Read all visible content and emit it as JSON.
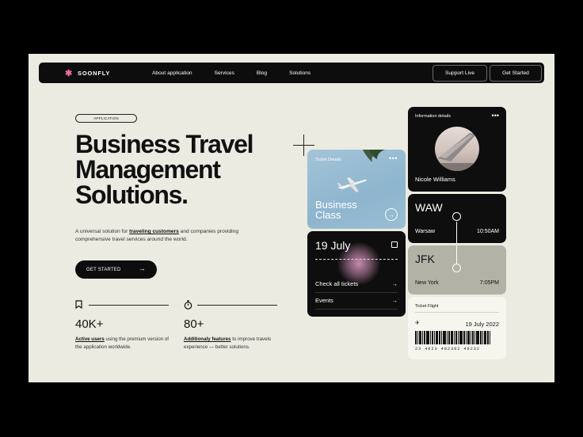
{
  "nav": {
    "brand": "SOONFLY",
    "links": [
      "About application",
      "Services",
      "Blog",
      "Solutions"
    ],
    "support_label": "Support Live",
    "start_label": "Get Started"
  },
  "hero": {
    "badge": "APPLICATION",
    "headline": [
      "Business Travel",
      "Management",
      "Solutions."
    ],
    "sub_pre": "A universal solution for ",
    "sub_bold": "traveling customers",
    "sub_post": " and companies providing comprehensive travel services around the world.",
    "cta": "GET STARTED"
  },
  "stats": [
    {
      "icon": "bookmark-icon",
      "value": "40K+",
      "bold": "Active users",
      "rest": " using the premium version of the application worldwide."
    },
    {
      "icon": "stopwatch-icon",
      "value": "80+",
      "bold": "Additionaly features",
      "rest": " to improve travels experience — better solutions."
    }
  ],
  "ticket_card": {
    "label": "Ticket Details",
    "title": [
      "Business",
      "Class"
    ]
  },
  "date_card": {
    "date": "19 July",
    "check": "Check all tickets",
    "events": "Events"
  },
  "info_card": {
    "label": "Information details",
    "name": "Nicole Williams"
  },
  "route": {
    "from": {
      "code": "WAW",
      "city": "Warsaw",
      "time": "10:50AM"
    },
    "to": {
      "code": "JFK",
      "city": "New York",
      "time": "7:05PM"
    }
  },
  "flight_card": {
    "label": "Ticket Flight",
    "date": "19 July 2022",
    "barcode_number": "23 4023 402302 40232"
  },
  "colors": {
    "accent_pink": "#ef6fa6",
    "highlight": "#e7b5cd",
    "background": "#ebebe2",
    "dark": "#0e0e0e",
    "sky": "#9bbfd4"
  }
}
